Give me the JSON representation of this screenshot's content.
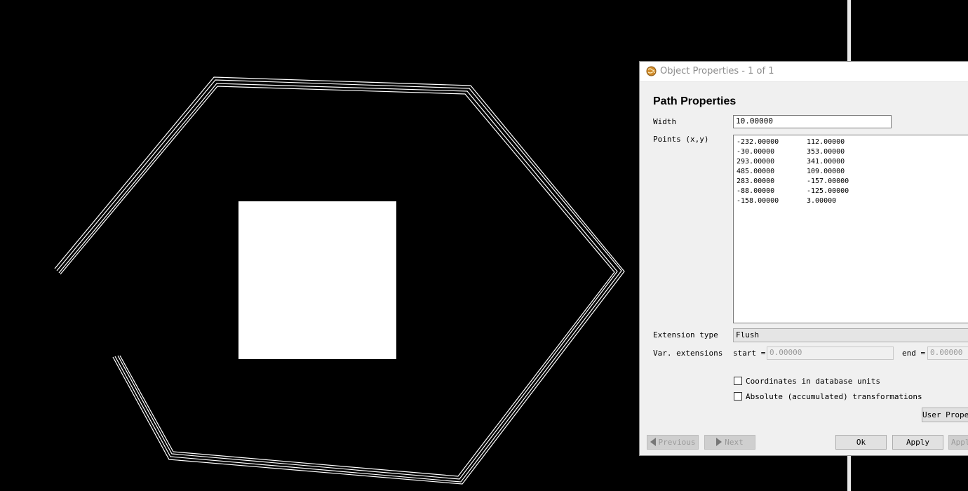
{
  "dialog": {
    "title": "Object Properties - 1 of 1",
    "heading": "Path Properties",
    "width": {
      "label": "Width",
      "value": "10.00000"
    },
    "points": {
      "label": "Points (x,y)",
      "rows": [
        [
          "-232.00000",
          "112.00000"
        ],
        [
          "-30.00000",
          "353.00000"
        ],
        [
          "293.00000",
          "341.00000"
        ],
        [
          "485.00000",
          "109.00000"
        ],
        [
          "283.00000",
          "-157.00000"
        ],
        [
          "-88.00000",
          "-125.00000"
        ],
        [
          "-158.00000",
          "3.00000"
        ]
      ]
    },
    "extension_type": {
      "label": "Extension type",
      "value": "Flush"
    },
    "var_extensions": {
      "label": "Var. extensions",
      "start_label": "start =",
      "start_value": "0.00000",
      "end_label": "end =",
      "end_value": "0.00000"
    },
    "checkboxes": {
      "db_units": "Coordinates in database units",
      "absolute": "Absolute (accumulated) transformations"
    },
    "buttons": {
      "user_properties": "User Proper",
      "previous": "Previous",
      "next": "Next",
      "ok": "Ok",
      "apply": "Apply",
      "apply_all": "Appl"
    }
  },
  "colors": {
    "canvas_bg": "#000000",
    "path_stroke": "#ffffff",
    "box_fill": "#ffffff"
  }
}
